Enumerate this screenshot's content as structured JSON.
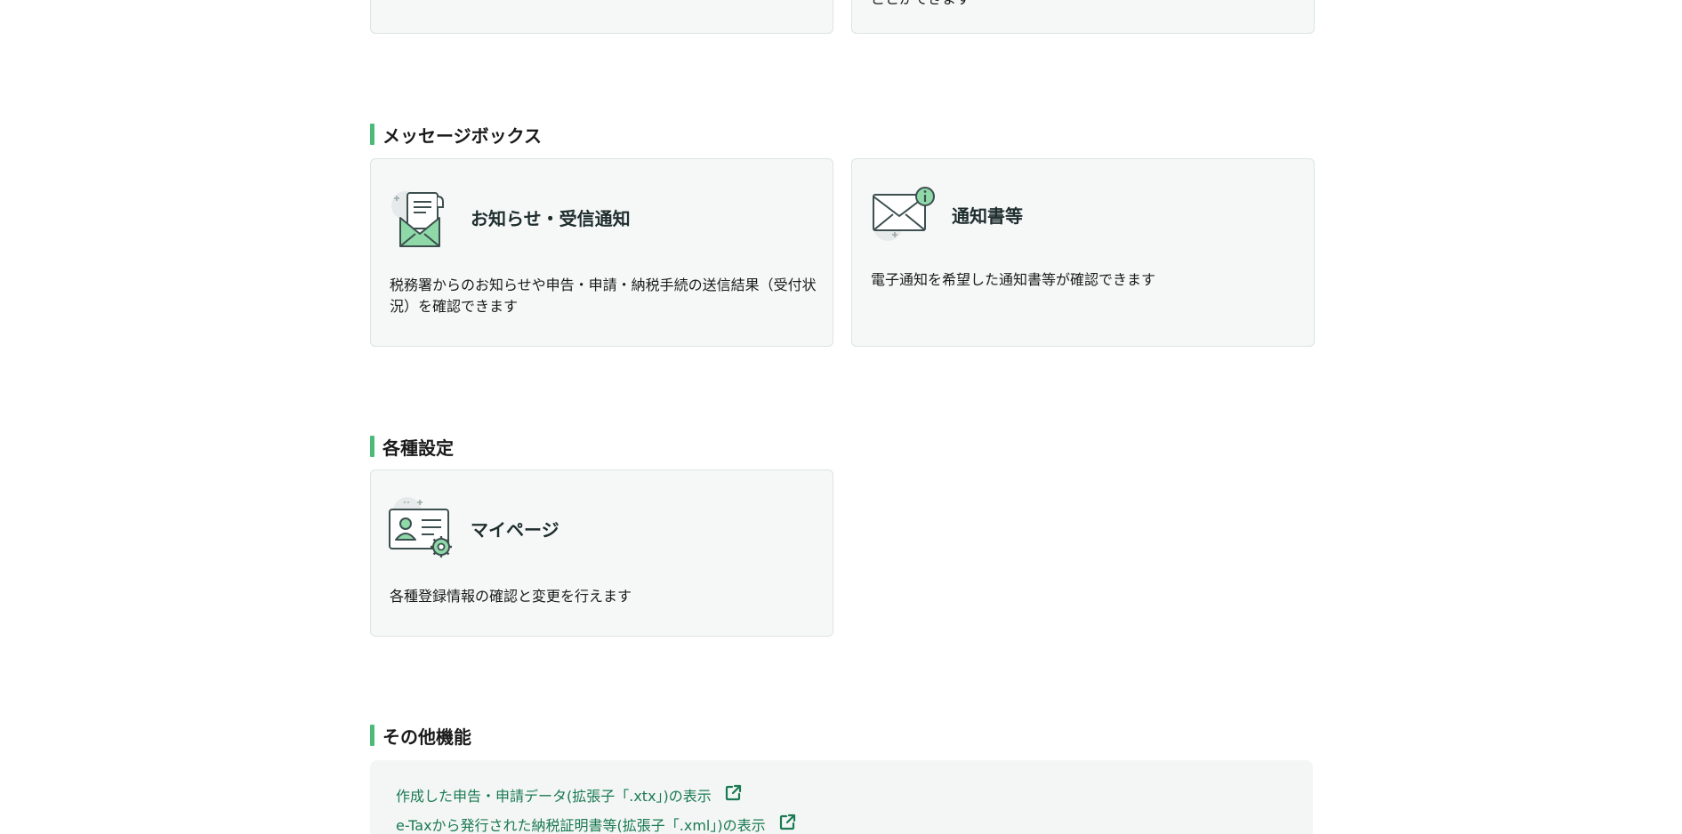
{
  "top_cards": {
    "right_partial_text": "ことができます"
  },
  "sections": {
    "messagebox": {
      "heading": "メッセージボックス",
      "cards": [
        {
          "title": "お知らせ・受信通知",
          "description": "税務署からのお知らせや申告・申請・納税手続の送信結果（受付状況）を確認できます",
          "icon": "envelope-letter-icon"
        },
        {
          "title": "通知書等",
          "description": "電子通知を希望した通知書等が確認できます",
          "icon": "envelope-info-icon"
        }
      ]
    },
    "settings": {
      "heading": "各種設定",
      "cards": [
        {
          "title": "マイページ",
          "description": "各種登録情報の確認と変更を行えます",
          "icon": "profile-card-gear-icon"
        }
      ]
    },
    "other": {
      "heading": "その他機能",
      "links": [
        {
          "label": "作成した申告・申請データ(拡張子「.xtx」)の表示",
          "icon": "external-link-icon"
        },
        {
          "label": "e-Taxから発行された納税証明書等(拡張子「.xml」)の表示",
          "icon": "external-link-icon"
        }
      ]
    }
  },
  "colors": {
    "accent_green": "#4cbb7a",
    "link_green": "#1a7a52",
    "icon_dark": "#3d4f4f",
    "icon_green": "#8fd9a8"
  }
}
